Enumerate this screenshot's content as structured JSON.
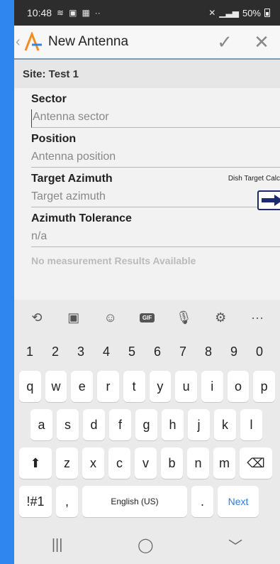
{
  "status": {
    "time": "10:48",
    "battery": "50%"
  },
  "appbar": {
    "title": "New Antenna"
  },
  "site": {
    "label": "Site: Test 1"
  },
  "fields": [
    {
      "label": "Sector",
      "placeholder": "Antenna sector"
    },
    {
      "label": "Position",
      "placeholder": "Antenna position"
    },
    {
      "label": "Target Azimuth",
      "placeholder": "Target azimuth",
      "extra": "Dish Target Calc"
    },
    {
      "label": "Azimuth Tolerance",
      "value": "n/a"
    }
  ],
  "no_results": "No measurement Results Available",
  "keyboard": {
    "numbers": [
      "1",
      "2",
      "3",
      "4",
      "5",
      "6",
      "7",
      "8",
      "9",
      "0"
    ],
    "row_q": [
      "q",
      "w",
      "e",
      "r",
      "t",
      "y",
      "u",
      "i",
      "o",
      "p"
    ],
    "row_a": [
      "a",
      "s",
      "d",
      "f",
      "g",
      "h",
      "j",
      "k",
      "l"
    ],
    "row_z": [
      "z",
      "x",
      "c",
      "v",
      "b",
      "n",
      "m"
    ],
    "symbols": "!#1",
    "comma": ",",
    "space": "English (US)",
    "period": ".",
    "next": "Next",
    "gif": "GIF"
  },
  "colors": {
    "accent": "#f58a1f",
    "brand_blue": "#2f86ee",
    "button_navy": "#1d2a6e"
  }
}
